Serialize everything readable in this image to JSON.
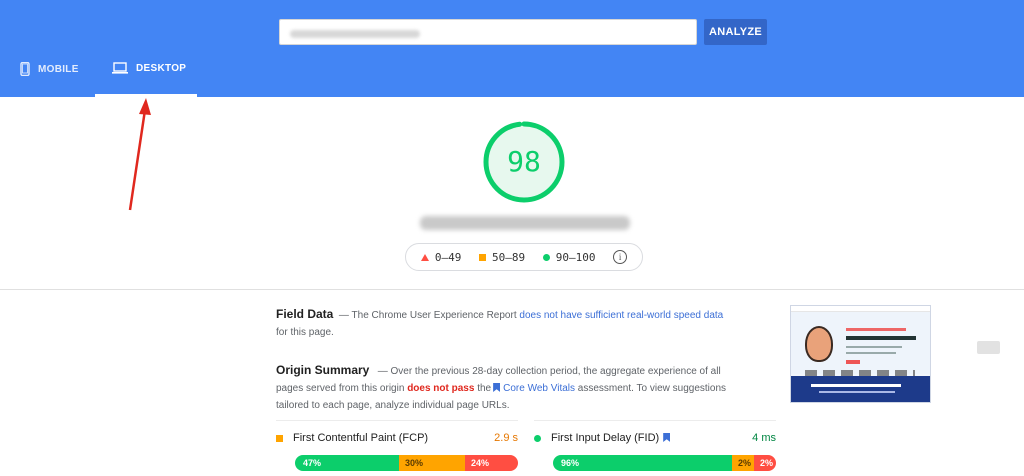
{
  "header": {
    "analyze_label": "ANALYZE",
    "tabs": [
      {
        "label": "MOBILE",
        "icon": "phone-icon",
        "active": false
      },
      {
        "label": "DESKTOP",
        "icon": "laptop-icon",
        "active": true
      }
    ]
  },
  "score": {
    "value": "98",
    "color": "#0cce6b"
  },
  "legend": {
    "poor": "0–49",
    "average": "50–89",
    "good": "90–100"
  },
  "field_data": {
    "title": "Field Data",
    "dash": "—",
    "text_before": "The Chrome User Experience Report",
    "link": "does not have sufficient real-world speed data",
    "text_after": "for this page."
  },
  "origin_summary": {
    "title": "Origin Summary",
    "dash": "—",
    "text_before": "Over the previous 28-day collection period, the aggregate experience of all pages served from this origin",
    "fail_text": "does not pass",
    "text_mid": "the",
    "link": "Core Web Vitals",
    "text_after": "assessment. To view suggestions tailored to each page, analyze individual page URLs."
  },
  "metrics": {
    "fcp": {
      "name": "First Contentful Paint (FCP)",
      "value": "2.9 s",
      "status": "average",
      "distribution": {
        "good": "47%",
        "average": "30%",
        "poor": "24%"
      },
      "fractions": [
        0.47,
        0.3,
        0.24
      ]
    },
    "fid": {
      "name": "First Input Delay (FID)",
      "value": "4 ms",
      "status": "good",
      "distribution": {
        "good": "96%",
        "average": "2%",
        "poor": "2%"
      },
      "fractions": [
        0.96,
        0.02,
        0.02
      ]
    }
  },
  "colors": {
    "header_bg": "#4385f4",
    "good": "#0cce6b",
    "average": "#ffa400",
    "poor": "#ff4e42",
    "link": "#3c6fd6",
    "annotation_arrow": "#e0281e"
  }
}
